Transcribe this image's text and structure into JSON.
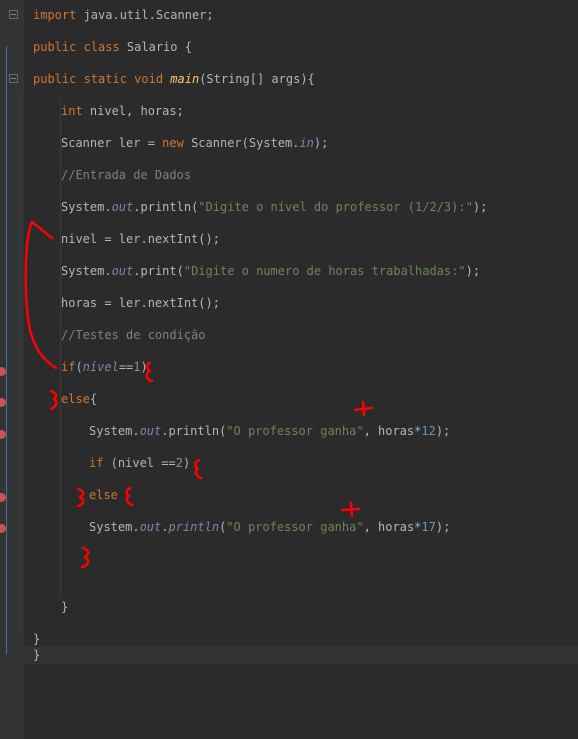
{
  "editor": {
    "language": "Java",
    "lines": [
      {
        "id": "l1",
        "segments": [
          [
            "kw",
            "import"
          ],
          [
            "cls",
            " java.util.Scanner;"
          ]
        ]
      },
      {
        "id": "l2",
        "segments": [
          [
            "kw",
            "public class "
          ],
          [
            "cls",
            "Salario {"
          ]
        ]
      },
      {
        "id": "l3",
        "segments": [
          [
            "kw",
            "public static void "
          ],
          [
            "fn",
            "main"
          ],
          [
            "cls",
            "(String[] args){"
          ]
        ]
      },
      {
        "id": "l4",
        "segments": [
          [
            "kw",
            "int"
          ],
          [
            "cls",
            " nivel, horas;"
          ]
        ]
      },
      {
        "id": "l5",
        "segments": [
          [
            "cls",
            "Scanner ler = "
          ],
          [
            "kw",
            "new"
          ],
          [
            "cls",
            " Scanner(System."
          ],
          [
            "field",
            "in"
          ],
          [
            "cls",
            ");"
          ]
        ]
      },
      {
        "id": "l6",
        "segments": [
          [
            "cmt",
            "//Entrada de Dados"
          ]
        ]
      },
      {
        "id": "l7",
        "segments": [
          [
            "cls",
            "System."
          ],
          [
            "field",
            "out"
          ],
          [
            "cls",
            ".println("
          ],
          [
            "str",
            "\"Digite o nível do professor (1/2/3):\""
          ],
          [
            "cls",
            ");"
          ]
        ]
      },
      {
        "id": "l8",
        "segments": [
          [
            "cls",
            "nivel = ler.nextInt();"
          ]
        ]
      },
      {
        "id": "l9",
        "segments": [
          [
            "cls",
            "System."
          ],
          [
            "field",
            "out"
          ],
          [
            "cls",
            ".print("
          ],
          [
            "str",
            "\"Digite o numero de horas trabalhadas:\""
          ],
          [
            "cls",
            ");"
          ]
        ]
      },
      {
        "id": "l10",
        "segments": [
          [
            "cls",
            "horas = ler.nextInt();"
          ]
        ]
      },
      {
        "id": "l11",
        "segments": [
          [
            "cmt",
            "//Testes de condição"
          ]
        ]
      },
      {
        "id": "l12",
        "segments": [
          [
            "kw",
            "if"
          ],
          [
            "cls",
            "("
          ],
          [
            "field",
            "nível"
          ],
          [
            "cls",
            "=="
          ],
          [
            "num",
            "1"
          ],
          [
            "cls",
            ")"
          ]
        ]
      },
      {
        "id": "l13",
        "segments": [
          [
            "kw",
            "else"
          ],
          [
            "cls",
            "{"
          ]
        ]
      },
      {
        "id": "l14",
        "segments": [
          [
            "cls",
            "System."
          ],
          [
            "field",
            "out"
          ],
          [
            "cls",
            ".println("
          ],
          [
            "str",
            "\"O professor ganha\""
          ],
          [
            "cls",
            ", horas*"
          ],
          [
            "num",
            "12"
          ],
          [
            "cls",
            ");"
          ]
        ]
      },
      {
        "id": "l15",
        "segments": [
          [
            "kw",
            "if"
          ],
          [
            "cls",
            " (nivel =="
          ],
          [
            "num",
            "2"
          ],
          [
            "cls",
            ")"
          ]
        ]
      },
      {
        "id": "l16",
        "segments": [
          [
            "kw",
            "else"
          ]
        ]
      },
      {
        "id": "l17",
        "segments": [
          [
            "cls",
            "System."
          ],
          [
            "field",
            "out"
          ],
          [
            "cls",
            "."
          ],
          [
            "field",
            "println"
          ],
          [
            "cls",
            "("
          ],
          [
            "str",
            "\"O professor ganha\""
          ],
          [
            "cls",
            ", horas*"
          ],
          [
            "num",
            "17"
          ],
          [
            "cls",
            ");"
          ]
        ]
      },
      {
        "id": "l18",
        "segments": [
          [
            "cls",
            "}"
          ]
        ]
      },
      {
        "id": "l19",
        "segments": [
          [
            "cls",
            "}"
          ]
        ]
      },
      {
        "id": "l20",
        "segments": [
          [
            "cls",
            "}"
          ]
        ]
      }
    ]
  },
  "colors": {
    "background": "#2b2b2b",
    "keyword": "#cc7832",
    "string": "#6a8759",
    "comment": "#808080",
    "number": "#6897bb",
    "field": "#9876aa",
    "annotation_ink": "#ff0000"
  },
  "annotations": {
    "plus_signs": [
      "+",
      "+"
    ]
  }
}
